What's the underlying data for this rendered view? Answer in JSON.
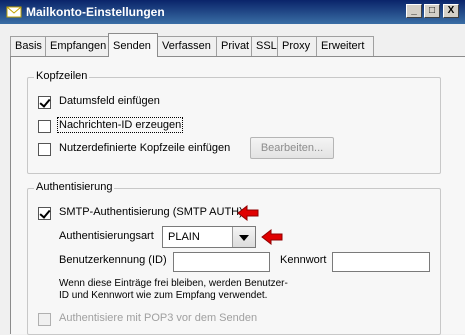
{
  "window": {
    "title": "Mailkonto-Einstellungen",
    "btn_min": "_",
    "btn_max": "□",
    "btn_close": "X"
  },
  "tabs": [
    {
      "label": "Basis"
    },
    {
      "label": "Empfangen"
    },
    {
      "label": "Senden",
      "active": true
    },
    {
      "label": "Verfassen"
    },
    {
      "label": "Privat"
    },
    {
      "label": "SSL"
    },
    {
      "label": "Proxy"
    },
    {
      "label": "Erweitert"
    }
  ],
  "kopfzeilen": {
    "legend": "Kopfzeilen",
    "datumsfeld": {
      "label": "Datumsfeld einfügen",
      "checked": true
    },
    "nachrichten_id": {
      "label": "Nachrichten-ID erzeugen",
      "checked": false
    },
    "nutzerdefiniert": {
      "label": "Nutzerdefinierte Kopfzeile einfügen",
      "checked": false
    },
    "bearbeiten_label": "Bearbeiten..."
  },
  "auth": {
    "legend": "Authentisierung",
    "smtp_auth": {
      "label": "SMTP-Authentisierung (SMTP AUTH)",
      "checked": true
    },
    "art_label": "Authentisierungsart",
    "art_value": "PLAIN",
    "user_label": "Benutzerkennung (ID)",
    "user_value": "",
    "pass_label": "Kennwort",
    "pass_value": "",
    "note_line1": "Wenn diese Einträge frei bleiben, werden Benutzer-",
    "note_line2": "ID und Kennwort wie zum Empfang verwendet.",
    "pop3": {
      "label": "Authentisiere mit POP3 vor dem Senden",
      "checked": false,
      "enabled": false
    }
  },
  "colors": {
    "annotation_arrow": "#e00000",
    "title_bar": "#0a246a"
  }
}
